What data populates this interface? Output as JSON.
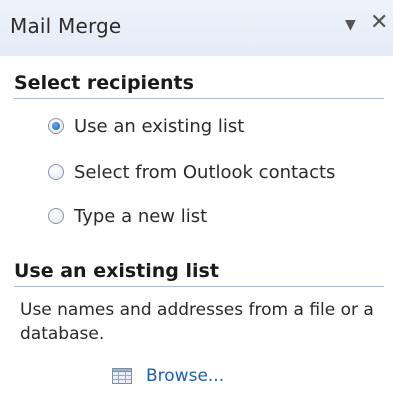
{
  "pane": {
    "title": "Mail Merge",
    "dropdown_glyph": "▼",
    "close_glyph": "✕"
  },
  "select_recipients": {
    "heading": "Select recipients",
    "options": [
      {
        "label": "Use an existing list",
        "checked": true
      },
      {
        "label": "Select from Outlook contacts",
        "checked": false
      },
      {
        "label": "Type a new list",
        "checked": false
      }
    ]
  },
  "existing_list": {
    "heading": "Use an existing list",
    "description": "Use names and addresses from a file or a database.",
    "browse_label": "Browse...",
    "browse_icon": "table-icon"
  },
  "colors": {
    "accent": "#1f5fad",
    "titlebar": "#e8eef7",
    "divider": "#a9b8cc"
  }
}
